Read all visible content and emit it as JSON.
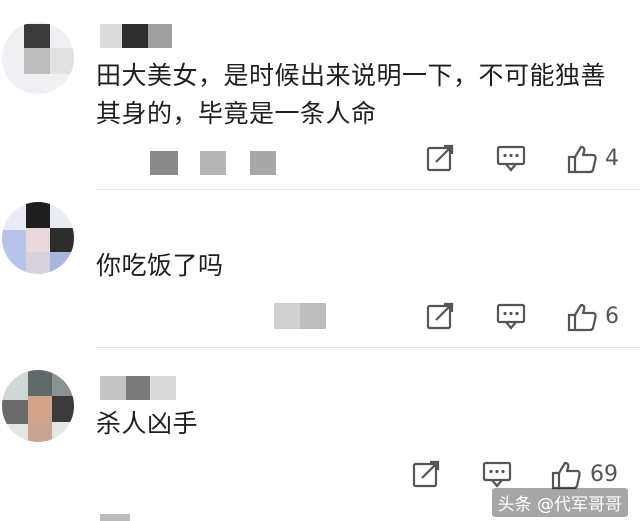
{
  "comments": [
    {
      "text": "田大美女，是时候出来说明一下，不可能独善其身的，毕竟是一条人命",
      "likes": "4"
    },
    {
      "text": "你吃饭了吗",
      "likes": "6"
    },
    {
      "text": "杀人凶手",
      "likes": "69"
    }
  ],
  "watermark": "头条 @代军哥哥",
  "icons": {
    "share": "share-icon",
    "reply": "comment-icon",
    "like": "thumbs-up-icon"
  },
  "colors": {
    "icon": "#555555",
    "divider": "#e6e6e6",
    "mosaic_dark": "#3a3a3a",
    "mosaic_mid": "#9a9a9a",
    "mosaic_light": "#d8d8d8"
  }
}
